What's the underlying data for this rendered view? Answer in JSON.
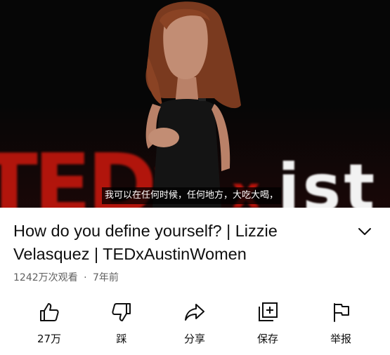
{
  "video": {
    "subtitle": "我可以在任何时候，任何地方，大吃大喝，",
    "background_letters_left": "TEDx",
    "background_letters_right": "ist",
    "background_letters_center": "x"
  },
  "title": "How do you define yourself? | Lizzie Velasquez | TEDxAustinWomen",
  "meta": {
    "views": "1242万次观看",
    "separator": "·",
    "age": "7年前"
  },
  "actions": [
    {
      "icon": "thumbs-up-icon",
      "label": "27万"
    },
    {
      "icon": "thumbs-down-icon",
      "label": "踩"
    },
    {
      "icon": "share-icon",
      "label": "分享"
    },
    {
      "icon": "save-playlist-icon",
      "label": "保存"
    },
    {
      "icon": "flag-icon",
      "label": "举报"
    }
  ],
  "colors": {
    "ted_red": "#c3170d",
    "text_primary": "#0f0f0f",
    "text_secondary": "#606060",
    "video_background": "#060606"
  }
}
